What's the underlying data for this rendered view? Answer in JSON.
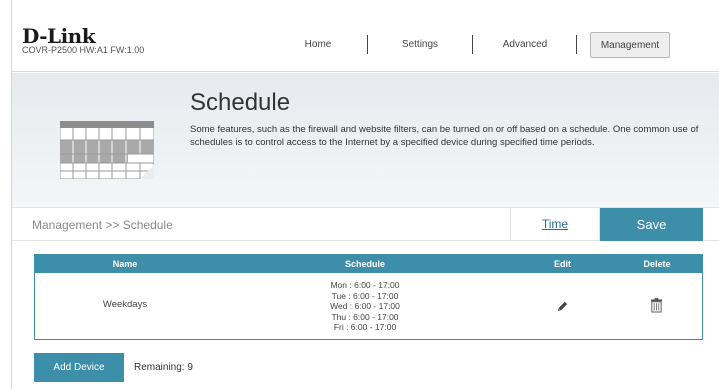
{
  "header": {
    "logo": "D-Link",
    "model_info": "COVR-P2500   HW:A1   FW:1.00",
    "nav": [
      {
        "label": "Home"
      },
      {
        "label": "Settings"
      },
      {
        "label": "Advanced"
      },
      {
        "label": "Management"
      }
    ],
    "active_nav": "Management"
  },
  "banner": {
    "title": "Schedule",
    "description": "Some features, such as the firewall and website filters, can be turned on or off based on a schedule. One common use of schedules is to control access to the Internet by a specified device during specified time periods.",
    "icon": "calendar-icon"
  },
  "breadcrumb": {
    "text": "Management >> Schedule",
    "time_link": "Time",
    "save_label": "Save"
  },
  "table": {
    "headers": {
      "name": "Name",
      "schedule": "Schedule",
      "edit": "Edit",
      "delete": "Delete"
    },
    "rows": [
      {
        "name": "Weekdays",
        "schedule": [
          "Mon : 6:00 - 17:00",
          "Tue : 6:00 - 17:00",
          "Wed : 6:00 - 17:00",
          "Thu : 6:00 - 17:00",
          "Fri : 6:00 - 17:00"
        ],
        "edit_icon": "pencil-icon",
        "delete_icon": "trash-icon"
      }
    ]
  },
  "footer": {
    "add_label": "Add Device",
    "remaining": "Remaining: 9"
  },
  "colors": {
    "accent": "#3d8ea8",
    "link": "#2c6e8e",
    "banner": "#eaedf0"
  }
}
